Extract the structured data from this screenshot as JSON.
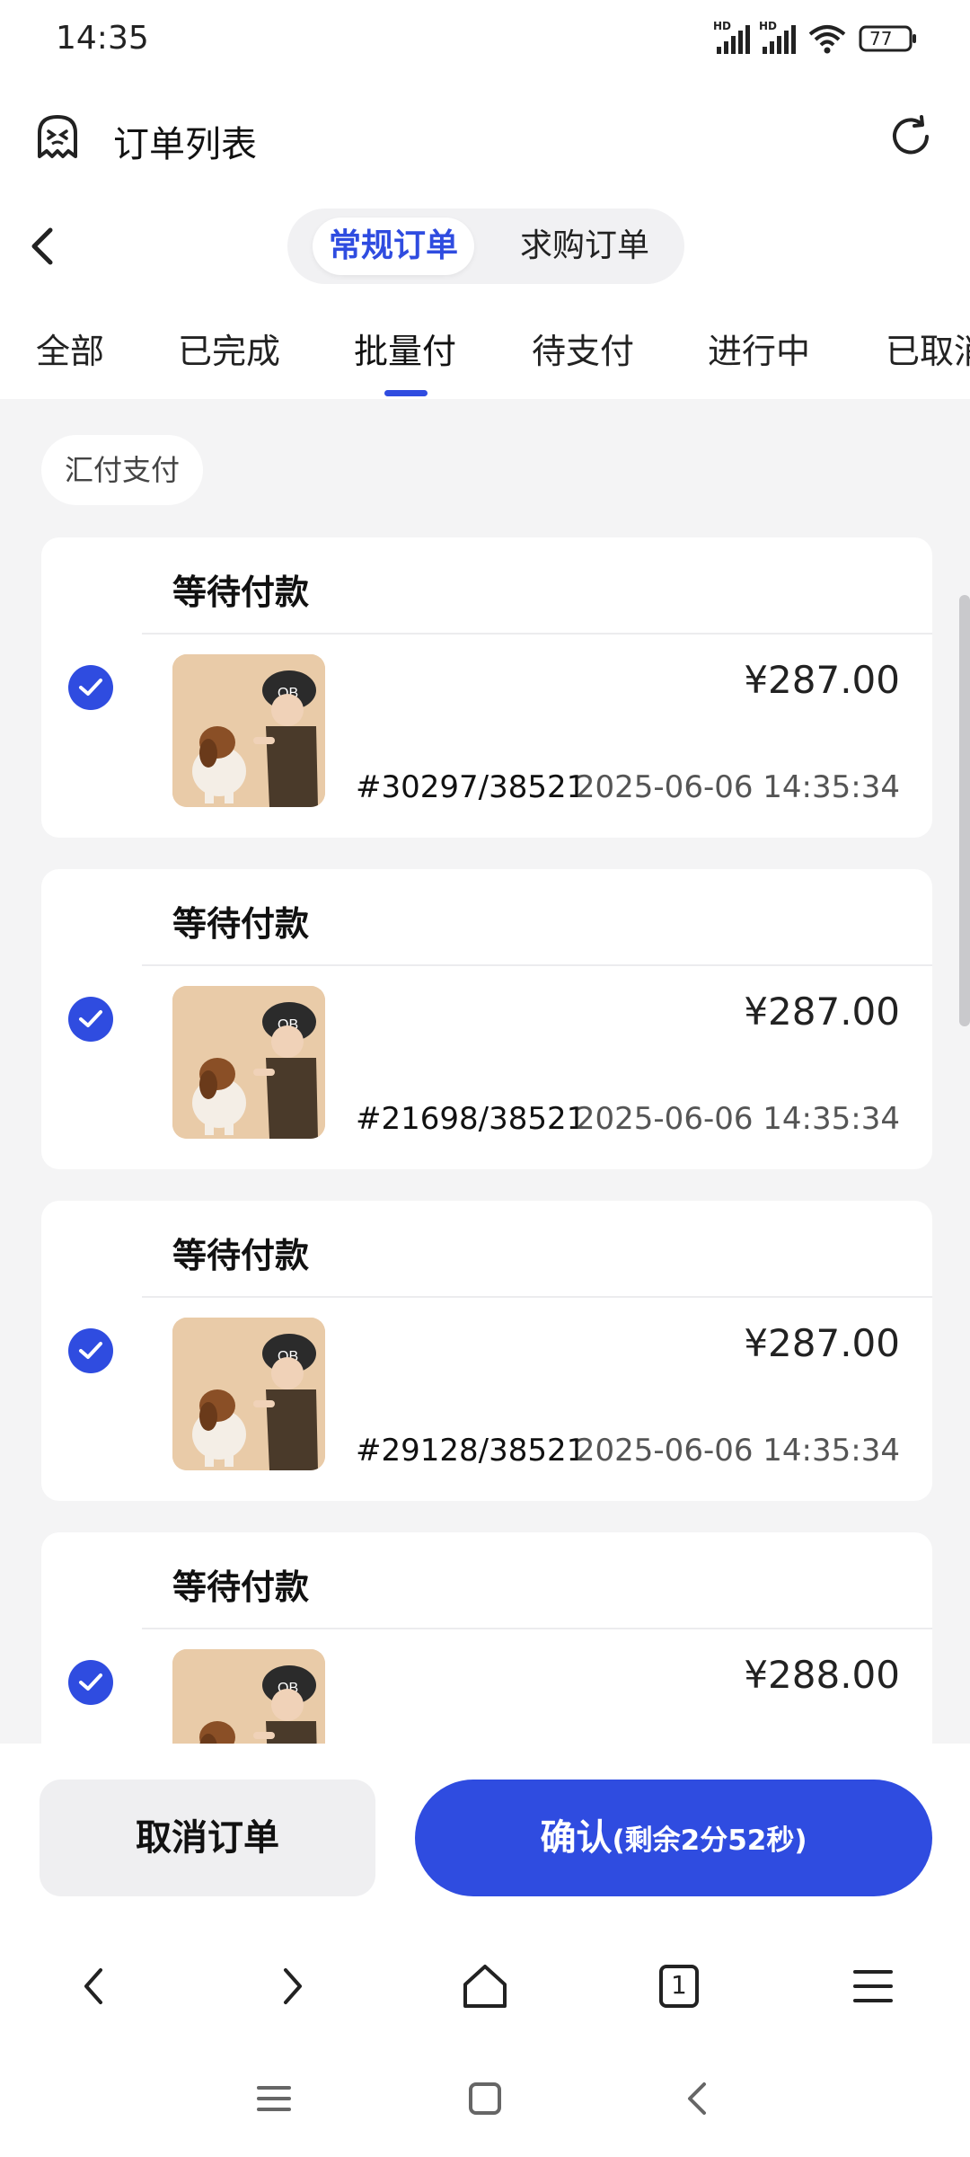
{
  "status_bar": {
    "time": "14:35",
    "battery": "77",
    "signal_label": "HD"
  },
  "header": {
    "title": "订单列表"
  },
  "segments": {
    "active": "常规订单",
    "inactive": "求购订单"
  },
  "tabs": [
    "全部",
    "已完成",
    "批量付",
    "待支付",
    "进行中",
    "已取消"
  ],
  "filter_chip": "汇付支付",
  "orders": [
    {
      "status": "等待付款",
      "price": "¥287.00",
      "order_no": "#30297/38521",
      "time": "2025-06-06 14:35:34",
      "selected": true
    },
    {
      "status": "等待付款",
      "price": "¥287.00",
      "order_no": "#21698/38521",
      "time": "2025-06-06 14:35:34",
      "selected": true
    },
    {
      "status": "等待付款",
      "price": "¥287.00",
      "order_no": "#29128/38521",
      "time": "2025-06-06 14:35:34",
      "selected": true
    },
    {
      "status": "等待付款",
      "price": "¥288.00",
      "order_no": "",
      "time": "",
      "selected": true
    }
  ],
  "actions": {
    "cancel": "取消订单",
    "confirm_main": "确认",
    "confirm_sub": "(剩余2分52秒)"
  },
  "browser_nav": {
    "tab_count": "1"
  },
  "colors": {
    "accent": "#2f4ce0",
    "background": "#f4f4f5"
  },
  "icons": [
    "ghost-icon",
    "refresh-icon",
    "back-icon",
    "check-icon",
    "product-image",
    "nav-back-icon",
    "nav-forward-icon",
    "home-icon",
    "tabs-icon",
    "menu-icon"
  ]
}
